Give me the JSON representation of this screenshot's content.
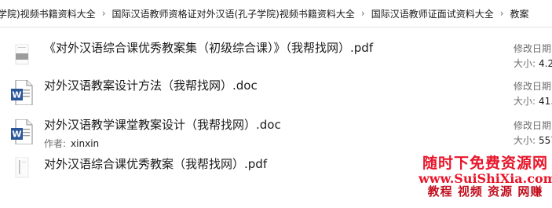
{
  "breadcrumb": {
    "items": [
      "学院)视频书籍资料大全",
      "国际汉语教师资格证对外汉语(孔子学院)视频书籍资料大全",
      "国际汉语教师证面试资料大全",
      "教案"
    ],
    "separator": "›"
  },
  "files": [
    {
      "name": "《对外汉语综合课优秀教案集（初级综合课）》（我帮找网）.pdf",
      "icon": "pdf-thumbnail-icon",
      "modified_label": "修改日期",
      "size_label": "大小:",
      "size_value": "4.2"
    },
    {
      "name": "对外汉语教案设计方法（我帮找网）.doc",
      "icon": "word-doc-icon",
      "modified_label": "修改日期",
      "size_label": "大小:",
      "size_value": "41."
    },
    {
      "name": "对外汉语教学课堂教案设计（我帮找网）.doc",
      "icon": "word-doc-icon",
      "author_label": "作者:",
      "author": "xinxin",
      "modified_label": "修改日期",
      "size_label": "大小:",
      "size_value": "557"
    },
    {
      "name": "对外汉语综合课优秀教案（我帮找网）.pdf",
      "icon": "pdf-thumbnail-icon"
    }
  ],
  "watermark": {
    "line1": "随时下免费资源网",
    "line2": "www.SuiShiXia.com",
    "line3": "教程 视频 资源 网赚"
  },
  "colors": {
    "word_blue": "#2b579a",
    "watermark_red": "#e8162b"
  }
}
